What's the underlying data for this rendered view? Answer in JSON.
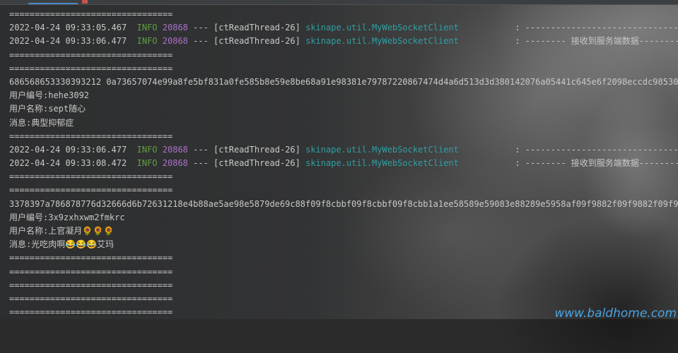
{
  "console": {
    "lines": [
      {
        "type": "sep",
        "text": "================================"
      },
      {
        "type": "log",
        "timestamp": "2022-04-24 09:33:05.467",
        "level": "INFO",
        "pid": "20868",
        "dashes": "---",
        "thread": "[ctReadThread-26]",
        "logger": "skinape.util.MyWebSocketClient",
        "message": "           : -------------------------------"
      },
      {
        "type": "log",
        "timestamp": "2022-04-24 09:33:06.477",
        "level": "INFO",
        "pid": "20868",
        "dashes": "---",
        "thread": "[ctReadThread-26]",
        "logger": "skinape.util.MyWebSocketClient",
        "message": "           : -------- 接收到服务端数据---------"
      },
      {
        "type": "sep",
        "text": "================================"
      },
      {
        "type": "sep",
        "text": "================================"
      },
      {
        "type": "plain",
        "text": "686568653330393212 0a73657074e99a8fe5bf831a0fe585b8e59e8be68a91e98381e79787220867474d4a6d513d3d380142076a05441c645e6f2098eccdc98530"
      },
      {
        "type": "plain",
        "text": "用户编号:hehe3092"
      },
      {
        "type": "plain",
        "text": "用户名称:sept随心"
      },
      {
        "type": "plain",
        "text": "消息:典型抑郁症"
      },
      {
        "type": "sep",
        "text": "================================"
      },
      {
        "type": "log",
        "timestamp": "2022-04-24 09:33:06.477",
        "level": "INFO",
        "pid": "20868",
        "dashes": "---",
        "thread": "[ctReadThread-26]",
        "logger": "skinape.util.MyWebSocketClient",
        "message": "           : -------------------------------"
      },
      {
        "type": "log",
        "timestamp": "2022-04-24 09:33:08.472",
        "level": "INFO",
        "pid": "20868",
        "dashes": "---",
        "thread": "[ctReadThread-26]",
        "logger": "skinape.util.MyWebSocketClient",
        "message": "           : -------- 接收到服务端数据---------"
      },
      {
        "type": "sep",
        "text": "================================"
      },
      {
        "type": "sep",
        "text": "================================"
      },
      {
        "type": "plain",
        "text": "3378397a786878776d32666d6b72631218e4b88ae5ae98e5879de69c88f09f8cbbf09f8cbbf09f8cbb1a1ee58589e59083e88289e5958af09f9882f09f9882f09f98"
      },
      {
        "type": "plain",
        "text": "用户编号:3x9zxhxwm2fmkrc"
      },
      {
        "type": "plain",
        "text": "用户名称:上官凝月🌻🌻🌻"
      },
      {
        "type": "plain",
        "text": "消息:光吃肉啊😂😂😂艾玛"
      },
      {
        "type": "sep",
        "text": "================================"
      },
      {
        "type": "sep",
        "text": "================================"
      },
      {
        "type": "sep",
        "text": "================================"
      },
      {
        "type": "sep",
        "text": "================================"
      },
      {
        "type": "sep",
        "text": "================================"
      }
    ]
  },
  "watermark": "www.baldhome.com",
  "colors": {
    "level_info": "#5e9f41",
    "pid": "#a871c8",
    "logger": "#2f9fa3",
    "watermark": "#4aa3e0"
  }
}
